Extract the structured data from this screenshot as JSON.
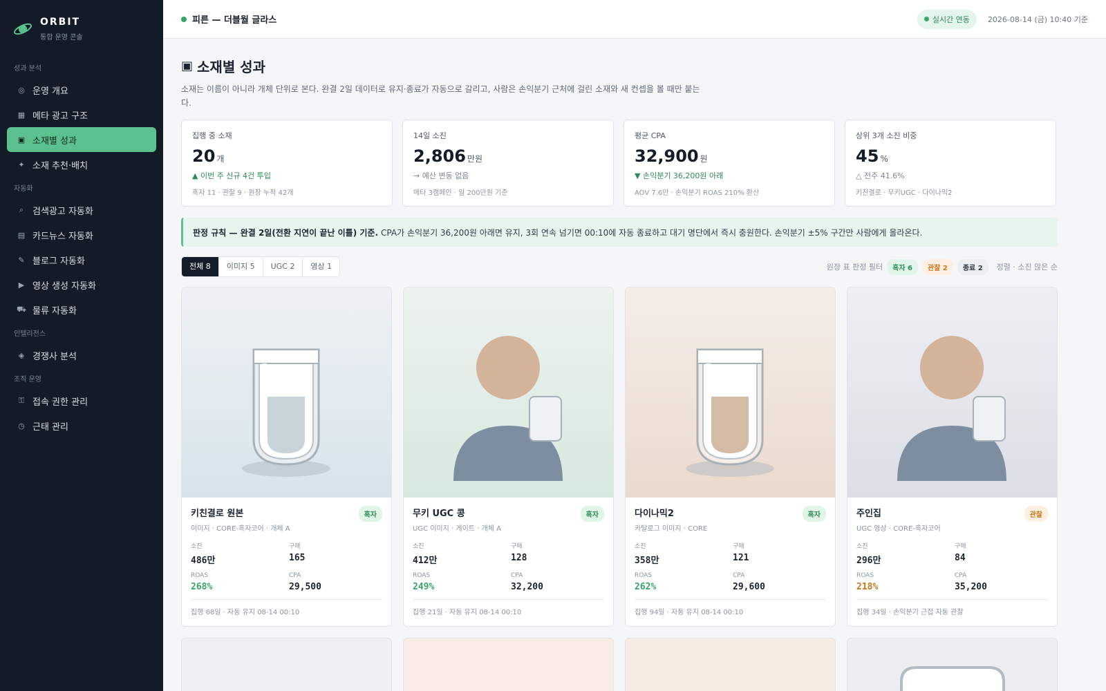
{
  "brand": {
    "name": "ORBIT",
    "subtitle": "통합 운영 콘솔",
    "logo_icon": "orbit-planet-icon"
  },
  "sidebar": {
    "sections": [
      {
        "label": "성과 분석",
        "items": [
          {
            "label": "운영 개요",
            "icon": "ring-icon",
            "glyph": "◎",
            "active": false
          },
          {
            "label": "메타 광고 구조",
            "icon": "table-icon",
            "glyph": "▦",
            "active": false
          },
          {
            "label": "소재별 성과",
            "icon": "square-icon",
            "glyph": "▣",
            "active": true
          },
          {
            "label": "소재 추천·배치",
            "icon": "sparkle-icon",
            "glyph": "✦",
            "active": false
          }
        ]
      },
      {
        "label": "자동화",
        "items": [
          {
            "label": "검색광고 자동화",
            "icon": "search-icon",
            "glyph": "⌕",
            "active": false
          },
          {
            "label": "카드뉴스 자동화",
            "icon": "cards-icon",
            "glyph": "▤",
            "active": false
          },
          {
            "label": "블로그 자동화",
            "icon": "pencil-icon",
            "glyph": "✎",
            "active": false
          },
          {
            "label": "영상 생성 자동화",
            "icon": "play-icon",
            "glyph": "▶",
            "active": false
          },
          {
            "label": "물류 자동화",
            "icon": "truck-icon",
            "glyph": "⛟",
            "active": false
          }
        ]
      },
      {
        "label": "인텔리전스",
        "items": [
          {
            "label": "경쟁사 분석",
            "icon": "diamond-icon",
            "glyph": "◈",
            "active": false
          }
        ]
      },
      {
        "label": "조직 운영",
        "items": [
          {
            "label": "접속 권한 관리",
            "icon": "key-icon",
            "glyph": "⚿",
            "active": false
          },
          {
            "label": "근태 관리",
            "icon": "clock-icon",
            "glyph": "◷",
            "active": false
          }
        ]
      }
    ]
  },
  "topbar": {
    "store": "피른 — 더블월 글라스",
    "live": "실시간 연동",
    "timestamp": "2026-08-14 (금) 10:40 기준"
  },
  "page": {
    "title_icon": "▣",
    "title": "소재별 성과",
    "description": "소재는 이름이 아니라 개체 단위로 본다. 완결 2일 데이터로 유지·종료가 자동으로 갈리고, 사람은 손익분기 근처에 걸린 소재와 새 컨셉을 볼 때만 붙는다."
  },
  "kpis": [
    {
      "label": "집행 중 소재",
      "value": "20",
      "unit": "개",
      "delta": "▲ 이번 주 신규 4건 투입",
      "delta_tone": "green",
      "foot": "흑자 11 · 관찰 9 · 원장 누적 42개"
    },
    {
      "label": "14일 소진",
      "value": "2,806",
      "unit": "만원",
      "delta": "→ 예산 변동 없음",
      "delta_tone": "gray",
      "foot": "메타 3캠페인 · 일 200만원 기준"
    },
    {
      "label": "평균 CPA",
      "value": "32,900",
      "unit": "원",
      "delta": "▼ 손익분기 36,200원 아래",
      "delta_tone": "green",
      "foot": "AOV 7.6만 · 손익분기 ROAS 210% 환산"
    },
    {
      "label": "상위 3개 소진 비중",
      "value": "45",
      "unit": "%",
      "delta": "△ 전주 41.6%",
      "delta_tone": "gray",
      "foot": "키친결로 · 무키UGC · 다이나믹2"
    }
  ],
  "rule": {
    "bold": "판정 규칙 — 완결 2일(전환 지연이 끝난 이틀) 기준.",
    "text": "CPA가 손익분기 36,200원 아래면 유지, 3회 연속 넘기면 00:10에 자동 종료하고 대기 명단에서 즉시 충원한다. 손익분기 ±5% 구간만 사람에게 올라온다."
  },
  "filters": {
    "tabs": [
      {
        "label": "전체 8",
        "active": true
      },
      {
        "label": "이미지 5",
        "active": false
      },
      {
        "label": "UGC 2",
        "active": false
      },
      {
        "label": "영상 1",
        "active": false
      }
    ],
    "ledger_label": "원장 표 판정 필터",
    "pill_win": "흑자 6",
    "pill_watch": "관찰 2",
    "pill_end": "종료 2",
    "sort": "정렬 · 소진 많은 순"
  },
  "metric_labels": {
    "spend": "소진",
    "purchases": "구매",
    "roas": "ROAS",
    "cpa": "CPA"
  },
  "creatives": [
    {
      "name": "키친결로 원본",
      "meta": "이미지 · CORE-흑자코어 · 개체 A",
      "status": "흑자",
      "status_tone": "win",
      "spend": "486만",
      "purchases": "165",
      "roas": "268%",
      "roas_tone": "green",
      "cpa": "29,500",
      "foot": "집행 68일 · 자동 유지 08-14 00:10",
      "thumb": "glass-clear",
      "bg_top": "#eef1f4",
      "bg_bottom": "#d7e4ec"
    },
    {
      "name": "무키 UGC 콩",
      "meta": "UGC 이미지 · 게이트 · 개체 A",
      "status": "흑자",
      "status_tone": "win",
      "spend": "412만",
      "purchases": "128",
      "roas": "249%",
      "roas_tone": "green",
      "cpa": "32,200",
      "foot": "집행 21일 · 자동 유지 08-14 00:10",
      "thumb": "person",
      "bg_top": "#edf2ef",
      "bg_bottom": "#d6e9de"
    },
    {
      "name": "다이나믹2",
      "meta": "카탈로그 이미지 · CORE",
      "status": "흑자",
      "status_tone": "win",
      "spend": "358만",
      "purchases": "121",
      "roas": "262%",
      "roas_tone": "green",
      "cpa": "29,600",
      "foot": "집행 94일 · 자동 유지 08-14 00:10",
      "thumb": "glass-latte",
      "bg_top": "#f4ede8",
      "bg_bottom": "#eadacd"
    },
    {
      "name": "주인집",
      "meta": "UGC 영상 · CORE-흑자코어",
      "status": "관찰",
      "status_tone": "watch",
      "spend": "296만",
      "purchases": "84",
      "roas": "218%",
      "roas_tone": "orange",
      "cpa": "35,200",
      "foot": "집행 34일 · 손익분기 근접 자동 관찰",
      "thumb": "person",
      "bg_top": "#eeeff3",
      "bg_bottom": "#dcdee6"
    }
  ],
  "second_row_backgrounds": [
    "#efeff4",
    "#f8ebe8",
    "#f6ece3",
    "#eceef1"
  ]
}
